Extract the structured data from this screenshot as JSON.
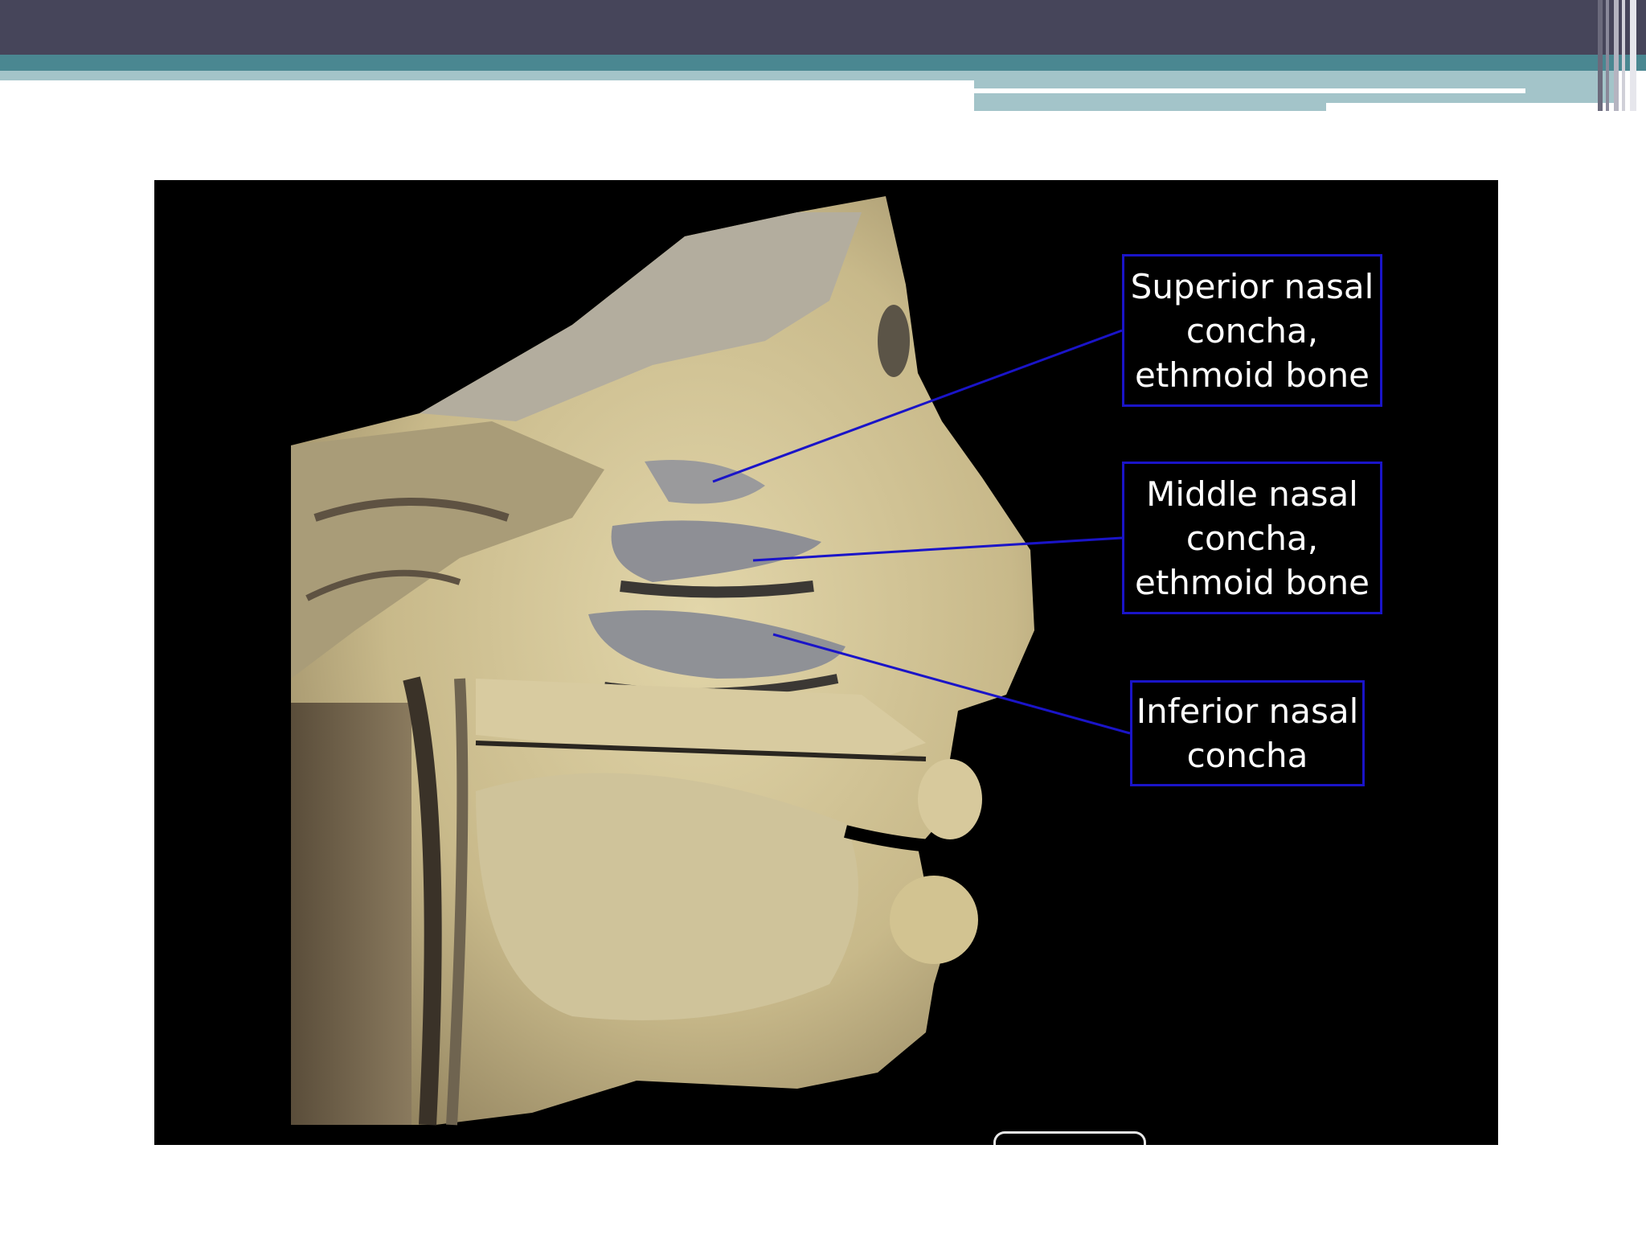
{
  "slide": {
    "labels": {
      "superior": "Superior nasal\nconcha,\nethmoid bone",
      "middle": "Middle nasal\nconcha,\nethmoid bone",
      "inferior": "Inferior nasal\nconcha"
    }
  },
  "colors": {
    "banner_dark": "#46455a",
    "banner_teal": "#4a8791",
    "banner_light": "#a3c4c9",
    "label_border": "#1a14c8",
    "pointer_line": "#1a14c8",
    "photo_background": "#000000",
    "tissue": "#cdbf92"
  },
  "icons": [
    "watermark-logo-icon"
  ]
}
